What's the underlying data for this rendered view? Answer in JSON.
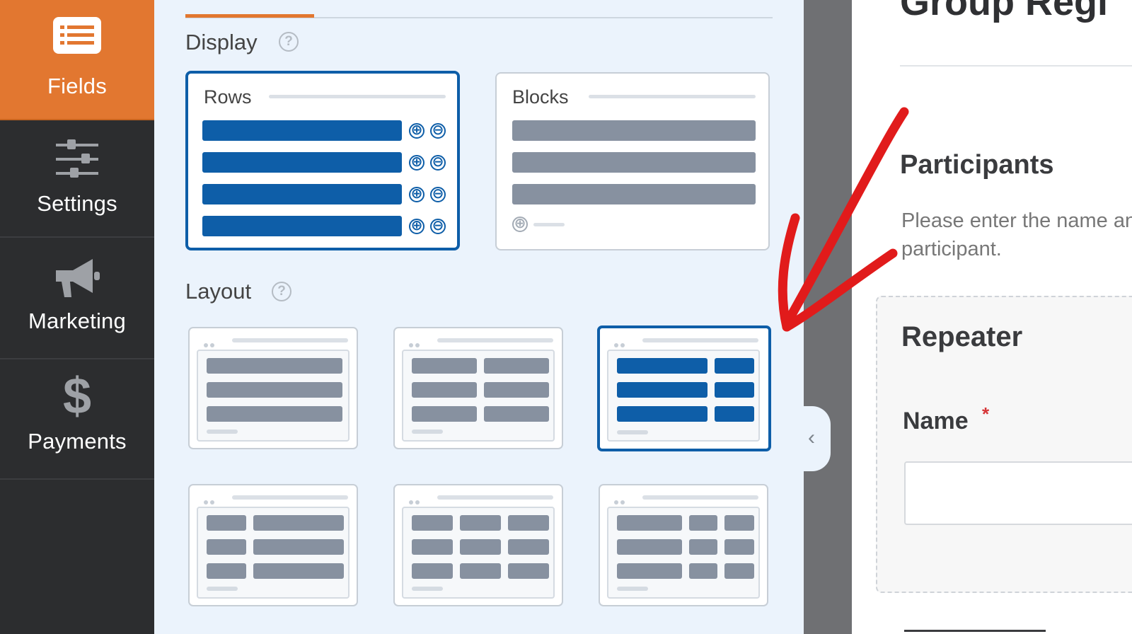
{
  "nav": {
    "items": [
      {
        "label": "Fields",
        "icon": "list-icon",
        "active": true
      },
      {
        "label": "Settings",
        "icon": "sliders-icon",
        "active": false
      },
      {
        "label": "Marketing",
        "icon": "megaphone-icon",
        "active": false
      },
      {
        "label": "Payments",
        "icon": "dollar-icon",
        "active": false
      }
    ]
  },
  "panel": {
    "display": {
      "title": "Display",
      "help_icon": "?",
      "options": [
        {
          "label": "Rows",
          "selected": true
        },
        {
          "label": "Blocks",
          "selected": false
        }
      ],
      "add_icon": "⊕",
      "remove_icon": "⊖"
    },
    "layout": {
      "title": "Layout",
      "help_icon": "?",
      "selected_index": 2
    }
  },
  "collapse_handle": {
    "icon": "chevron-left-icon",
    "glyph": "‹"
  },
  "preview": {
    "form_title": "Group Regi",
    "section_title": "Participants",
    "description": "Please enter the name another participant.",
    "repeater_title": "Repeater",
    "field_label": "Name",
    "required_mark": "*",
    "name_value": ""
  },
  "colors": {
    "accent": "#e27730",
    "selected": "#0e5ea8",
    "nav_bg": "#2c2d2f",
    "annotation": "#e11b1b"
  }
}
